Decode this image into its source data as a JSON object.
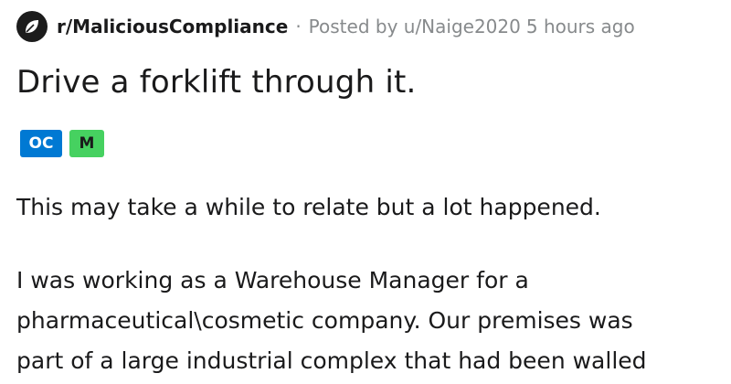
{
  "header": {
    "subreddit": "r/MaliciousCompliance",
    "separator": "·",
    "posted_by": "Posted by u/Naige2020",
    "time_ago": "5 hours ago",
    "icon": "subreddit-icon"
  },
  "post": {
    "title": "Drive a forklift through it.",
    "flairs": [
      {
        "label": "OC",
        "color": "#0079d3"
      },
      {
        "label": "M",
        "color": "#46d160"
      }
    ],
    "paragraph1": "This may take a while to relate but a lot happened.",
    "paragraph2_lines": [
      "I was working as a Warehouse Manager for a",
      "pharmaceutical\\cosmetic company. Our premises was",
      "part of a large industrial complex that had been walled"
    ]
  }
}
